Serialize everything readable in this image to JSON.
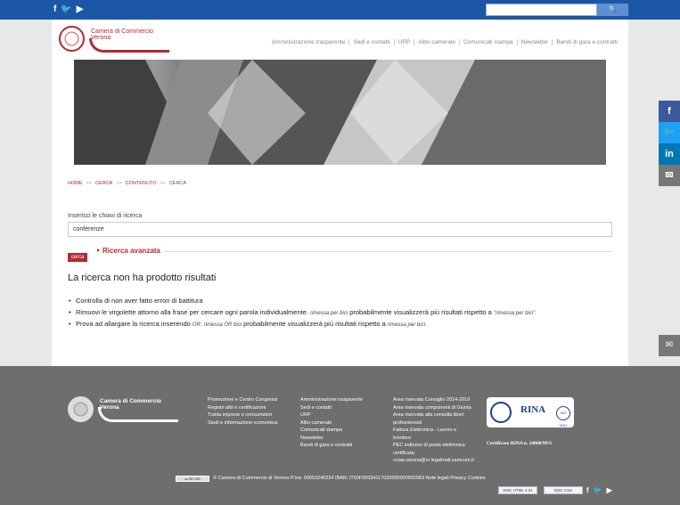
{
  "topbar": {
    "social": [
      {
        "icon": "facebook-icon",
        "glyph": "f"
      },
      {
        "icon": "twitter-icon",
        "glyph": "🐦"
      },
      {
        "icon": "youtube-icon",
        "glyph": "▶"
      }
    ],
    "search_placeholder": "",
    "search_icon": "🔍"
  },
  "logo": {
    "line1": "Camera di Commercio",
    "line2": "Verona"
  },
  "nav": [
    "Amministrazione trasparente",
    "Sedi e contatti",
    "URP",
    "Albo camerale",
    "Comunicati stampa",
    "Newsletter",
    "Bandi di gara e contratti"
  ],
  "breadcrumb": [
    {
      "label": "HOME"
    },
    {
      "label": "CERCA"
    },
    {
      "label": "CONTENUTO"
    },
    {
      "label": "CERCA"
    }
  ],
  "breadcrumb_sep": ">>",
  "search": {
    "label": "Inserisci le chiavi di ricerca",
    "value": "conferenze",
    "advanced": "Ricerca avanzata",
    "button": "cerca"
  },
  "result": {
    "heading": "La ricerca non ha prodotto risultati",
    "tips": [
      {
        "text": "Controlla di non aver fatto errori di battitura"
      },
      {
        "text": "Rimuovi le virgolette attorno alla frase per cercare ogni parola individualmente.",
        "example": "rimessa per bici",
        "text2": "probabilmente visualizzerà più risultati rispetto a",
        "example2": "\"rimessa per bici\"."
      },
      {
        "text": "Prova ad allargare la ricerca inserendo",
        "example": "OR.",
        "example_b": "rimessa OR bici",
        "text2": "probabilmente visualizzerà più risultati rispetto a",
        "example2": "rimessa per bici."
      }
    ]
  },
  "share": [
    {
      "icon": "facebook-icon",
      "glyph": "f",
      "color": "#3b5998"
    },
    {
      "icon": "twitter-icon",
      "glyph": "🐦",
      "color": "#1da1f2"
    },
    {
      "icon": "linkedin-icon",
      "glyph": "in",
      "color": "#0077b5"
    },
    {
      "icon": "email-icon",
      "glyph": "✉",
      "color": "#777777"
    }
  ],
  "side_mail_glyph": "✉",
  "footer": {
    "logo": {
      "line1": "Camera di Commercio",
      "line2": "Verona"
    },
    "col1": [
      "Promozione e Centro Congressi",
      "Registri albi e certificazioni",
      "Tutela imprese e consumatori",
      "Studi e informazione economica"
    ],
    "col2": [
      "Amministrazione trasparente",
      "Sedi e contatti",
      "URP",
      "Albo camerale",
      "Comunicati stampa",
      "Newsletter",
      "Bandi di gara e contratti"
    ],
    "col3": [
      "Area riservata Consiglio 2014-2019",
      "Area riservata componenti di Giunta",
      "Area riservata alla consulta liberi",
      "professionisti",
      "Fattura Elettronica - Lavoro e",
      "fornitore",
      "PEC indirizzo di posta elettronica",
      "certificata:",
      "cciaa.verona@vr.legalmail.camcom.it"
    ],
    "rina": {
      "title": "RINA",
      "iso": "ISO 9001"
    },
    "certificate": "Certificato RINA n. 24060/99/S",
    "cc_badge": "cc BY-ND",
    "copyright": "© Camera di Commercio di Verona P.Iva: 00653240234 IBAN: IT60F05034117020000000002063 Note legali Privacy Cookies",
    "badges": [
      "W3C HTML 4.01",
      "W3C CSS"
    ],
    "social": [
      {
        "icon": "facebook-icon",
        "glyph": "f"
      },
      {
        "icon": "twitter-icon",
        "glyph": "🐦"
      },
      {
        "icon": "youtube-icon",
        "glyph": "▶"
      }
    ]
  },
  "colors": {
    "brand_blue": "#1b57a6",
    "brand_red": "#b5282e",
    "footer_grey": "#6e6e6e"
  }
}
